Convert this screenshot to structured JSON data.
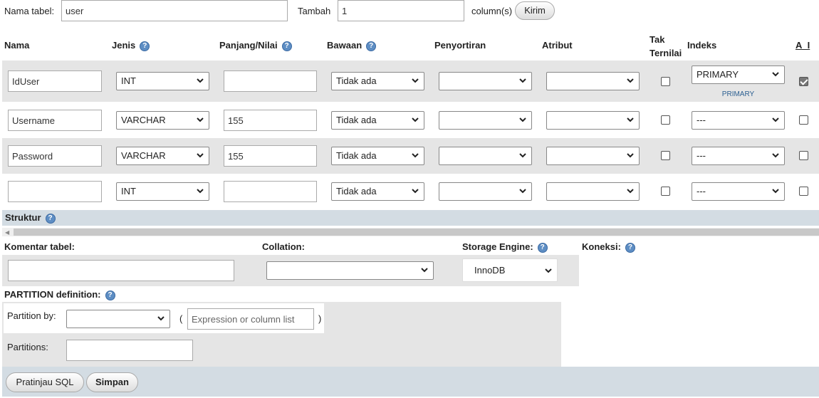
{
  "top": {
    "table_name_label": "Nama tabel:",
    "table_name_value": "user",
    "add_label": "Tambah",
    "add_value": "1",
    "columns_label": "column(s)",
    "go_button": "Kirim"
  },
  "headers": {
    "name": "Nama",
    "type": "Jenis",
    "length": "Panjang/Nilai",
    "default": "Bawaan",
    "collation": "Penyortiran",
    "attribute": "Atribut",
    "null_line1": "Tak",
    "null_line2": "Ternilai",
    "index": "Indeks",
    "ai": "A_I"
  },
  "rows": [
    {
      "name": "IdUser",
      "type": "INT",
      "length": "",
      "default": "Tidak ada",
      "collation": "",
      "attribute": "",
      "null": false,
      "index": "PRIMARY",
      "index_note": "PRIMARY",
      "ai": true
    },
    {
      "name": "Username",
      "type": "VARCHAR",
      "length": "155",
      "default": "Tidak ada",
      "collation": "",
      "attribute": "",
      "null": false,
      "index": "---",
      "index_note": "",
      "ai": false
    },
    {
      "name": "Password",
      "type": "VARCHAR",
      "length": "155",
      "default": "Tidak ada",
      "collation": "",
      "attribute": "",
      "null": false,
      "index": "---",
      "index_note": "",
      "ai": false
    },
    {
      "name": "",
      "type": "INT",
      "length": "",
      "default": "Tidak ada",
      "collation": "",
      "attribute": "",
      "null": false,
      "index": "---",
      "index_note": "",
      "ai": false
    }
  ],
  "structure": {
    "label": "Struktur"
  },
  "table_options": {
    "comment_label": "Komentar tabel:",
    "comment_value": "",
    "collation_label": "Collation:",
    "collation_value": "",
    "engine_label": "Storage Engine:",
    "engine_value": "InnoDB",
    "connection_label": "Koneksi:"
  },
  "partition": {
    "title": "PARTITION definition:",
    "by_label": "Partition by:",
    "by_value": "",
    "open_paren": "(",
    "expression_placeholder": "Expression or column list",
    "close_paren": ")",
    "partitions_label": "Partitions:",
    "partitions_value": ""
  },
  "footer": {
    "preview_button": "Pratinjau SQL",
    "save_button": "Simpan"
  },
  "colors": {
    "row_even": "#e5e5e5",
    "row_odd": "#ffffff",
    "section_bar": "#d3dce3",
    "help_icon": "#5e8ec4",
    "scrollbar": "#c8c8c8"
  }
}
